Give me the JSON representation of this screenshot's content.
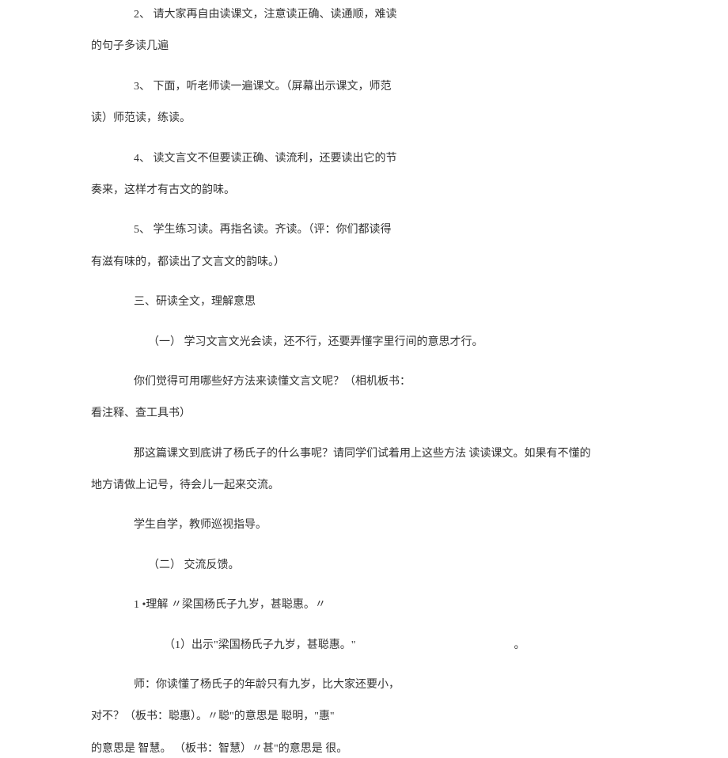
{
  "paragraphs": {
    "p1_line1": "2、 请大家再自由读课文，注意读正确、读通顺，难读",
    "p1_line2": "的句子多读几遍",
    "p2_line1": "3、 下面，听老师读一遍课文。（屏幕出示课文，师范",
    "p2_line2": "读）师范读，练读。",
    "p3_line1": "4、 读文言文不但要读正确、读流利，还要读出它的节",
    "p3_line2": "奏来，这样才有古文的韵味。",
    "p4_line1": "5、 学生练习读。再指名读。齐读。（评：你们都读得",
    "p4_line2": "有滋有味的，都读出了文言文的韵味。）",
    "p5": "三、研读全文，理解意思",
    "p6": "（一） 学习文言文光会读，还不行，还要弄懂字里行间的意思才行。",
    "p7_line1": "你们觉得可用哪些好方法来读懂文言文呢？（相机板书：",
    "p7_line2": "看注释、查工具书）",
    "p8_line1": "那这篇课文到底讲了杨氏子的什么事呢？请同学们试着用上这些方法 读读课文。如果有不懂的",
    "p8_line2": "地方请做上记号，待会儿一起来交流。",
    "p9": "学生自学，教师巡视指导。",
    "p10": "（二） 交流反馈。",
    "p11": "1 •理解        〃梁国杨氏子九岁，甚聪惠。〃",
    "p12_text": "（1）出示\"梁国杨氏子九岁，甚聪惠。\"",
    "p12_dot": "。",
    "p13_line1": "师：你读懂了杨氏子的年龄只有九岁，比大家还要小，",
    "p13_line2": "对不？（板书：聪惠）。〃聪\"的意思是 聪明，\"惠\"",
    "p13_line3": "的意思是 智慧。        （板书：智慧）〃甚\"的意思是 很。"
  }
}
